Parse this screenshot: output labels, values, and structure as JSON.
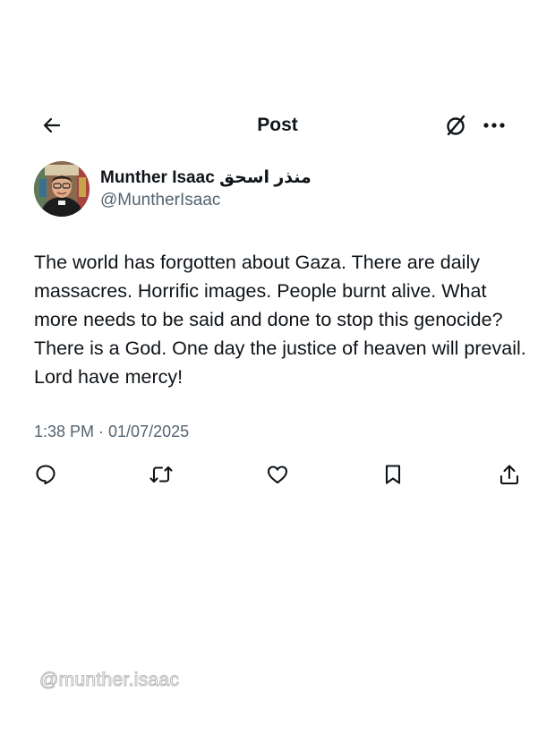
{
  "header": {
    "title": "Post",
    "back_icon": "arrow-left-icon",
    "grok_icon": "grok-icon",
    "more_icon": "more-horizontal-icon"
  },
  "author": {
    "display_name": "Munther Isaac منذر اسحق",
    "handle": "@MuntherIsaac",
    "avatar": "profile-photo"
  },
  "post": {
    "text": "The world has forgotten about Gaza. There are daily massacres. Horrific images. People burnt alive. What more needs to be said and done to stop this genocide? There is a God. One day the justice of heaven will prevail. Lord have mercy!",
    "timestamp": "1:38 PM · 01/07/2025"
  },
  "actions": [
    {
      "name": "reply",
      "icon": "reply-icon"
    },
    {
      "name": "repost",
      "icon": "repost-icon"
    },
    {
      "name": "like",
      "icon": "heart-icon"
    },
    {
      "name": "bookmark",
      "icon": "bookmark-icon"
    },
    {
      "name": "share",
      "icon": "share-icon"
    }
  ],
  "watermark": "@munther.isaac",
  "colors": {
    "text_primary": "#0f1419",
    "text_secondary": "#536471",
    "background": "#ffffff"
  }
}
